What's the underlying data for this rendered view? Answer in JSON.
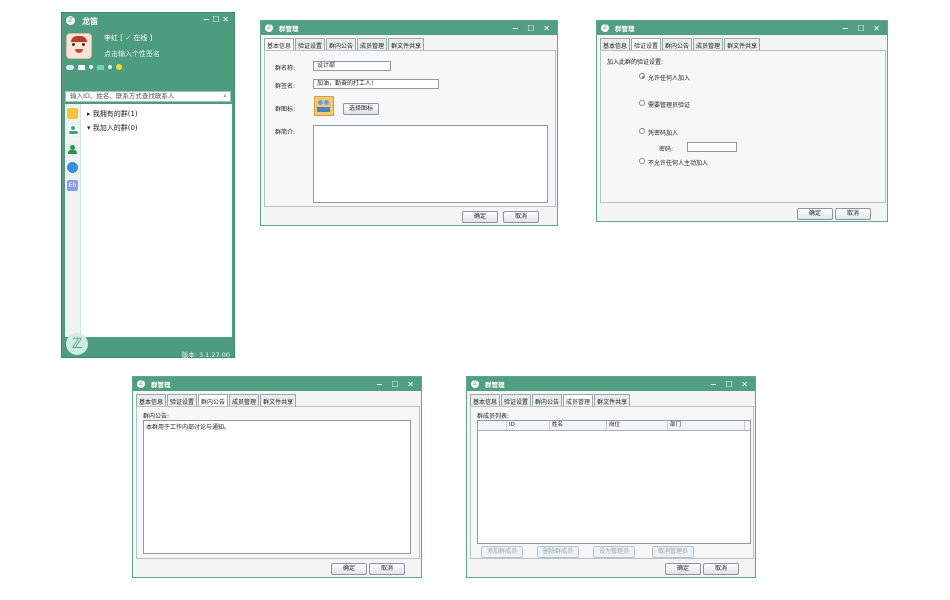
{
  "client": {
    "title": "龙笛",
    "username": "李红",
    "status_open": "[",
    "status": "在线",
    "status_close": "]",
    "signature": "点击输入个性签名",
    "search_placeholder": "输入ID、姓名、联系方式查找联系人",
    "groups": [
      {
        "arrow": "▸",
        "label": "我拥有的群(1)"
      },
      {
        "arrow": "▾",
        "label": "我加入的群(0)"
      }
    ],
    "version": "版本: 3.1.27.00",
    "logo_glyph": "ℤ",
    "win_controls": "− ☐ ✕"
  },
  "dialogs": {
    "title": "群管理",
    "win_controls": "− ☐ ✕",
    "tabs": [
      "基本信息",
      "验证设置",
      "群内公告",
      "成员管理",
      "群文件共享"
    ],
    "ok": "确定",
    "cancel": "取消"
  },
  "basic": {
    "name_label": "群名称:",
    "name_value": "设计部",
    "sig_label": "群签名:",
    "sig_value": "加油，勤奋的打工人!",
    "icon_label": "群图标:",
    "choose_icon": "选择图标",
    "intro_label": "群简介:"
  },
  "verify": {
    "heading": "加入此群的验证设置:",
    "opt1": "允许任何人加入",
    "opt2": "需要管理员验证",
    "opt3": "凭密码加入",
    "password_label": "密码:",
    "opt4": "不允许任何人主动加入",
    "selected": "opt1"
  },
  "notice": {
    "heading": "群内公告:",
    "text": "本群用于工作内部讨论与通知。"
  },
  "members": {
    "heading": "群成员列表:",
    "columns": [
      "",
      "ID",
      "姓名",
      "岗位",
      "部门"
    ],
    "buttons": [
      "添加群成员",
      "删除群成员",
      "设为管理员",
      "取消管理员"
    ]
  },
  "colors": {
    "accent": "#4f9f80",
    "panel_border": "#b8c0c8"
  }
}
